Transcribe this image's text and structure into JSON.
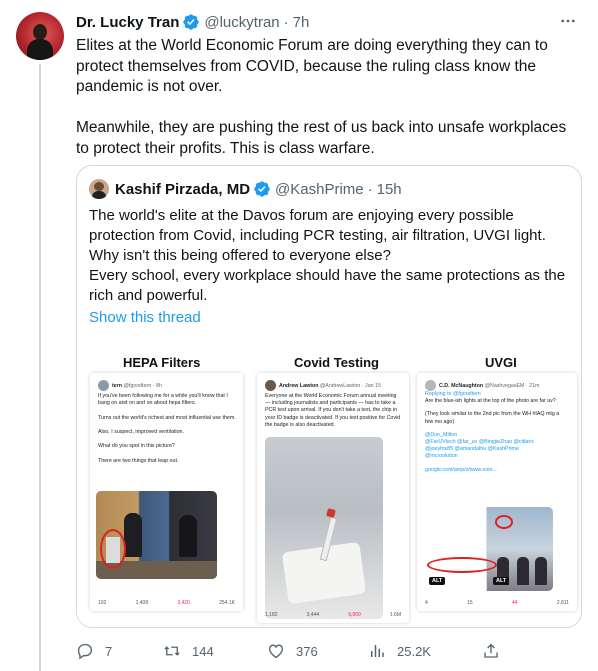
{
  "tweet": {
    "author_name": "Dr. Lucky Tran",
    "author_handle": "@luckytran",
    "separator": "·",
    "time": "7h",
    "text": "Elites at the World Economic Forum are doing everything they can to protect themselves from COVID, because the ruling class know the pandemic is not over.\n\nMeanwhile, they are pushing the rest of us back into unsafe workplaces to protect their profits. This is class warfare.",
    "more_icon": "more-horizontal-icon"
  },
  "quote": {
    "author_name": "Kashif Pirzada, MD",
    "author_handle": "@KashPrime",
    "separator": "·",
    "time": "15h",
    "text": "The world's elite at the Davos forum are enjoying every possible protection from Covid, including PCR testing, air filtration, UVGI light. Why isn't this being offered to everyone else?\nEvery school, every workplace should have the same protections as the rich and powerful.",
    "thread_link": "Show this thread"
  },
  "media": {
    "panels": [
      {
        "title": "HEPA Filters",
        "author": "tern",
        "handle": "@fgoodtern · 8h",
        "text": "If you've been following me for a while you'll know that I bang on and on and on about hepa filters.\n\nTurns out the world's richest and most influential use them.\n\nAlso, I suspect, improved ventilation.\n\nWhat do you spot in this picture?\n\nThere are two things that leap out.",
        "stats": [
          "102",
          "1,408",
          "3,420",
          "254.1K"
        ]
      },
      {
        "title": "Covid Testing",
        "author": "Andrew Lawton",
        "handle": "@AndrewLawton · Jan 15",
        "text": "Everyone at the World Economic Forum annual meeting — including journalists and participants — has to take a PCR test upon arrival. If you don't take a test, the chip in your ID badge is deactivated. If you test positive for Covid the badge is also deactivated.",
        "stats": [
          "1,182",
          "3,444",
          "9,900",
          "1.6M"
        ]
      },
      {
        "title": "UVGI",
        "author": "C.D. McNaughton",
        "handle": "@NashvegasEM · 21m",
        "reply": "Replying to @fgoodtern",
        "text": "Are the blue-ish lights at the top of the photo are far uv?",
        "text2": "(They look similar to the 2nd pic from the WH #IAQ mtg a few mo ago)",
        "mentions": "@Don_Milton\n@FarUVtech @far_uv @BingjieZhao @citlanx\n@joeyfox85 @amandalhu @KashPrime\n@mcrookston",
        "url": "google.com/amp/s/www.ooin...",
        "alt": "ALT",
        "stats": [
          "4",
          "15",
          "44",
          "2,811"
        ]
      }
    ]
  },
  "actions": {
    "replies": "7",
    "retweets": "144",
    "likes": "376",
    "views": "25.2K"
  },
  "colors": {
    "accent": "#1d9bf0",
    "secondary_text": "#536471",
    "border": "#cfd9de",
    "like": "#f91880"
  }
}
